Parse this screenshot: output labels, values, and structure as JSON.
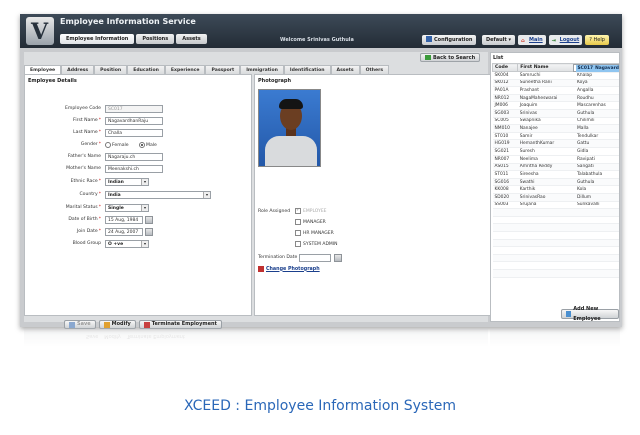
{
  "header": {
    "title": "Employee Information Service",
    "main_tabs": [
      {
        "label": "Employee Information",
        "active": true
      },
      {
        "label": "Positions",
        "active": false
      },
      {
        "label": "Assets",
        "active": false
      }
    ],
    "welcome": "Welcome Srinivas Guthula",
    "configuration": "Configuration",
    "default_select": "Default",
    "main_link": "Main",
    "logout_link": "Logout",
    "help": "Help"
  },
  "back_button": "Back to Search",
  "sub_tabs": [
    {
      "label": "Employee",
      "active": true
    },
    {
      "label": "Address",
      "active": false
    },
    {
      "label": "Position",
      "active": false
    },
    {
      "label": "Education",
      "active": false
    },
    {
      "label": "Experience",
      "active": false
    },
    {
      "label": "Passport",
      "active": false
    },
    {
      "label": "Immigration",
      "active": false
    },
    {
      "label": "Identification",
      "active": false
    },
    {
      "label": "Assets",
      "active": false
    },
    {
      "label": "Others",
      "active": false
    }
  ],
  "details": {
    "section_title": "Employee Details",
    "employee_code": {
      "label": "Employee Code",
      "value": "SC017"
    },
    "first_name": {
      "label": "First Name",
      "value": "NagavardhanRaju"
    },
    "last_name": {
      "label": "Last Name",
      "value": "Challa"
    },
    "gender": {
      "label": "Gender",
      "options": [
        "Female",
        "Male"
      ],
      "selected": "Male"
    },
    "fathers_name": {
      "label": "Father's Name",
      "value": "Nagaraju.ch"
    },
    "mothers_name": {
      "label": "Mother's Name",
      "value": "Meenakshi.ch"
    },
    "ethnic_race": {
      "label": "Ethnic Race",
      "value": "Indian"
    },
    "country": {
      "label": "Country",
      "value": "India"
    },
    "marital_status": {
      "label": "Marital Status",
      "value": "Single"
    },
    "date_of_birth": {
      "label": "Date of Birth",
      "value": "15 Aug, 1984"
    },
    "join_date": {
      "label": "Join Date",
      "value": "24 Aug, 2007"
    },
    "blood_group": {
      "label": "Blood Group",
      "value": "O +ve"
    }
  },
  "buttons": {
    "save": "Save",
    "modify": "Modify",
    "terminate": "Terminate Employment"
  },
  "photo": {
    "title": "Photograph",
    "role_label": "Role Assigned",
    "roles": [
      {
        "label": "EMPLOYEE",
        "checked": true,
        "disabled": true
      },
      {
        "label": "MANAGER",
        "checked": false,
        "disabled": false
      },
      {
        "label": "HR MANAGER",
        "checked": false,
        "disabled": false
      },
      {
        "label": "SYSTEM ADMIN",
        "checked": false,
        "disabled": false
      }
    ],
    "termination_label": "Termination Date",
    "change_photo": "Change Photograph"
  },
  "list": {
    "title": "List",
    "columns": [
      "Code",
      "First Name",
      "Last Name"
    ],
    "rows": [
      [
        "SK004",
        "Samruchi",
        "Khalap"
      ],
      [
        "SK012",
        "Suneetha Rani",
        "Koya"
      ],
      [
        "PA01A",
        "Prashant",
        "Angalla"
      ],
      [
        "NR012",
        "NagaMaheswarai",
        "Roudhu"
      ],
      [
        "JM006",
        "Joaquim",
        "Mascarenhas"
      ],
      [
        "SG003",
        "Srinivas",
        "Guthula"
      ],
      [
        "SC005",
        "Swapnika",
        "Chilimili"
      ],
      [
        "NM010",
        "Nanajee",
        "Malla"
      ],
      [
        "ST010",
        "Samir",
        "Tendulkar"
      ],
      [
        "HG019",
        "HemanthKumar",
        "Gattu"
      ],
      [
        "SG021",
        "Suresh",
        "Gidla"
      ],
      [
        "SC017",
        "NagavardhanRaj",
        "Challa"
      ],
      [
        "NR007",
        "Neelima",
        "Ravipati"
      ],
      [
        "AS015",
        "Amritha Reddy",
        "Sangati"
      ],
      [
        "ST011",
        "Sireesha",
        "Talabathula"
      ],
      [
        "SG016",
        "Swathi",
        "Guthula"
      ],
      [
        "KK008",
        "Karthik",
        "Kola"
      ],
      [
        "SD020",
        "SrinivasRao",
        "Dillum"
      ],
      [
        "SS003",
        "Srujana",
        "Sunkavalli"
      ]
    ],
    "selected_code": "SC017",
    "add_button": "Add New Employee"
  },
  "caption": "XCEED : Employee Information System",
  "colors": {
    "accent": "#2a67b8",
    "selected_row": "#8fc5f0",
    "header_bg": "#2b3440"
  }
}
